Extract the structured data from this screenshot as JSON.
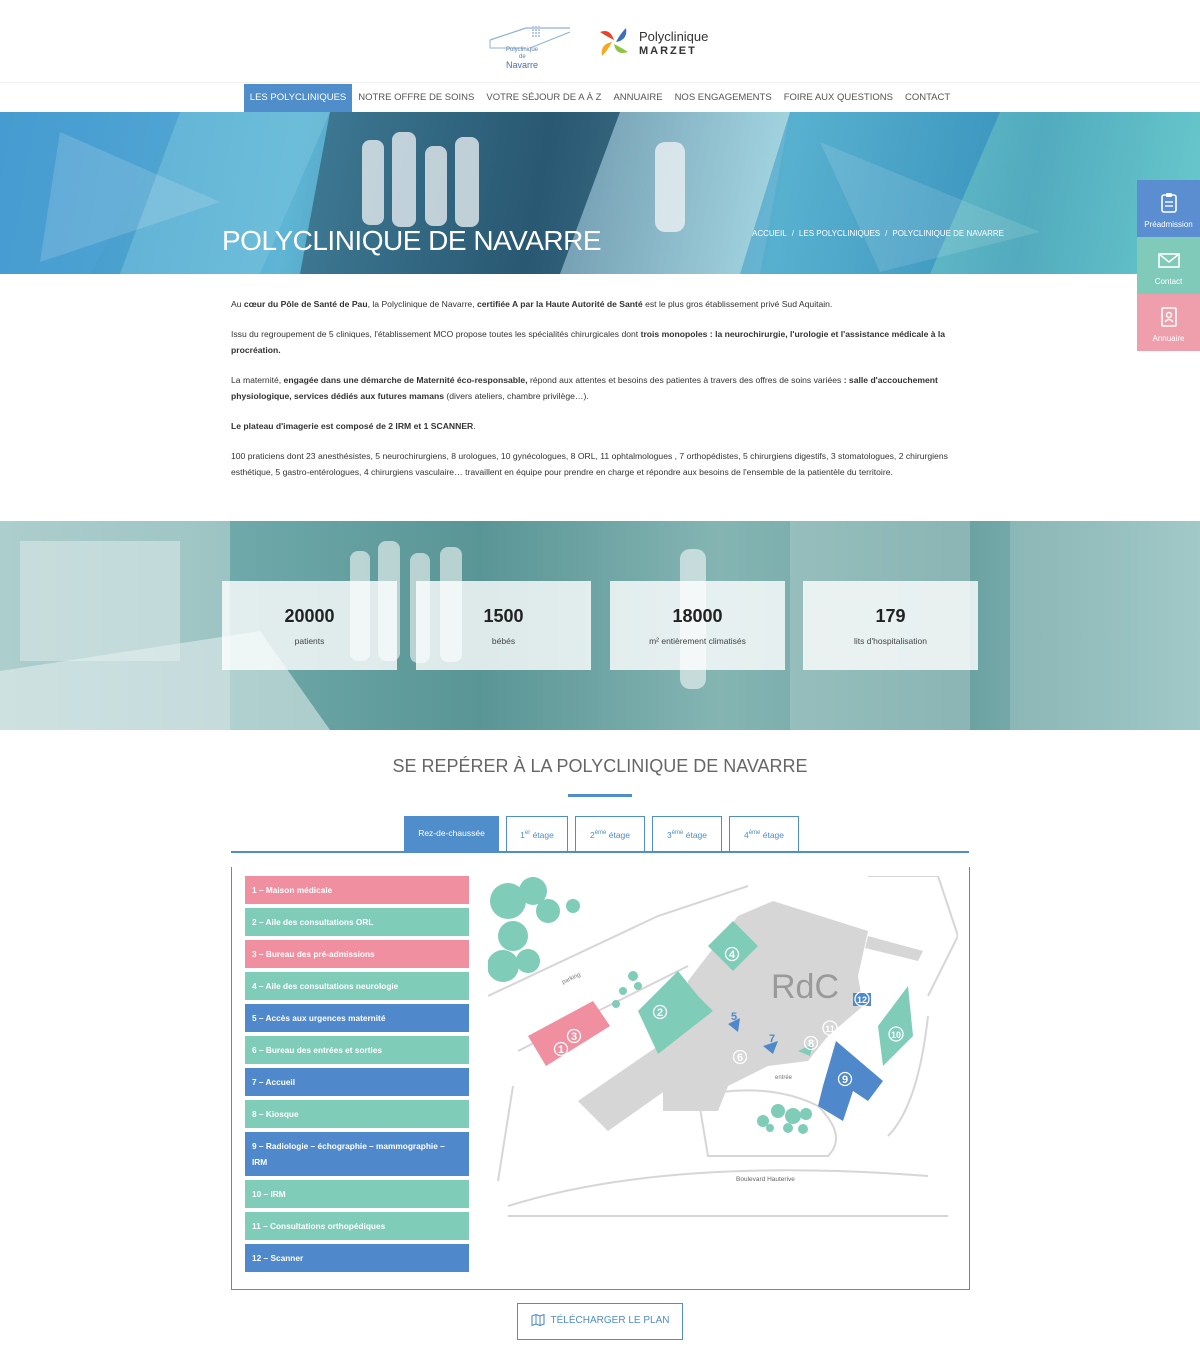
{
  "header": {
    "logo_navarre": {
      "line1": "Polyclinique",
      "line2": "de",
      "line3": "Navarre"
    },
    "logo_marzet": {
      "line1": "Polyclinique",
      "line2": "MARZET"
    }
  },
  "nav": {
    "items": [
      "LES POLYCLINIQUES",
      "NOTRE OFFRE DE SOINS",
      "VOTRE SÉJOUR DE A À Z",
      "ANNUAIRE",
      "NOS ENGAGEMENTS",
      "FOIRE AUX QUESTIONS",
      "CONTACT"
    ],
    "active_index": 0
  },
  "hero": {
    "title": "POLYCLINIQUE DE NAVARRE",
    "breadcrumb": [
      "ACCUEIL",
      "LES POLYCLINIQUES",
      "POLYCLINIQUE DE NAVARRE"
    ],
    "separator": "/"
  },
  "side_tabs": {
    "preadmission": "Préadmission",
    "contact": "Contact",
    "annuaire": "Annuaire"
  },
  "intro": {
    "p1": {
      "a": "Au ",
      "b": "cœur du Pôle de Santé de Pau",
      "c": ", la Polyclinique de Navarre, ",
      "d": "certifiée A par la Haute Autorité de Santé",
      "e": " est le plus gros établissement privé Sud Aquitain."
    },
    "p2": {
      "a": "Issu du regroupement de 5 cliniques, l'établissement MCO propose toutes les spécialités chirurgicales dont ",
      "b": "trois monopoles : la neurochirurgie, l'urologie et l'assistance médicale à la procréation."
    },
    "p3": {
      "a": "La maternité, ",
      "b": "engagée dans une démarche de Maternité éco-responsable,",
      "c": " répond aux attentes et besoins des patientes à travers des offres de soins variées ",
      "d": ": salle d'accouchement physiologique, services dédiés aux futures mamans",
      "e": " (divers ateliers, chambre privilège…)."
    },
    "p4": {
      "a": "Le plateau d'imagerie est composé de 2 IRM et  1 SCANNER",
      "b": "."
    },
    "p5": "100 praticiens dont 23 anesthésistes, 5 neurochirurgiens, 8 urologues, 10 gynécologues, 8 ORL, 11 ophtalmologues , 7 orthopédistes, 5 chirurgiens digestifs, 3 stomatologues, 2 chirurgiens esthétique, 5 gastro-entérologues, 4 chirurgiens vasculaire…  travaillent en équipe pour prendre en charge et répondre aux besoins de l'ensemble de la patientèle du territoire."
  },
  "stats": [
    {
      "value": "20000",
      "label": "patients"
    },
    {
      "value": "1500",
      "label": "bébés"
    },
    {
      "value": "18000",
      "label": "m² entièrement climatisés"
    },
    {
      "value": "179",
      "label": "lits d'hospitalisation"
    }
  ],
  "plan": {
    "title": "SE REPÉRER À LA POLYCLINIQUE DE NAVARRE",
    "tabs": [
      {
        "label": "Rez-de-chaussée",
        "sup": "",
        "after": ""
      },
      {
        "label": "1",
        "sup": "er",
        "after": " étage"
      },
      {
        "label": "2",
        "sup": "ème",
        "after": " étage"
      },
      {
        "label": "3",
        "sup": "ème",
        "after": " étage"
      },
      {
        "label": "4",
        "sup": "ème",
        "after": " étage"
      }
    ],
    "active_tab": 0,
    "legend": [
      {
        "label": "1 – Maison médicale",
        "color": "pink"
      },
      {
        "label": "2 – Aile des consultations ORL",
        "color": "green"
      },
      {
        "label": "3 – Bureau des pré-admissions",
        "color": "pink"
      },
      {
        "label": "4 – Aile des consultations neurologie",
        "color": "green"
      },
      {
        "label": "5 – Accès aux urgences maternité",
        "color": "blue"
      },
      {
        "label": "6 – Bureau des entrées et sorties",
        "color": "green"
      },
      {
        "label": "7 – Accueil",
        "color": "blue"
      },
      {
        "label": "8 – Kiosque",
        "color": "green"
      },
      {
        "label": "9 – Radiologie – échographie – mammographie – IRM",
        "color": "blue"
      },
      {
        "label": "10 – IRM",
        "color": "green"
      },
      {
        "label": "11 – Consultations orthopédiques",
        "color": "green"
      },
      {
        "label": "12 – Scanner",
        "color": "blue"
      }
    ],
    "map": {
      "floor_label": "RdC",
      "parking": "parking",
      "entree": "entrée",
      "street": "Boulevard Hauterive",
      "markers": [
        "1",
        "2",
        "3",
        "4",
        "5",
        "6",
        "7",
        "8",
        "9",
        "10",
        "11",
        "12"
      ]
    },
    "download": "TÉLÉCHARGER LE PLAN"
  },
  "colors": {
    "blue": "#4f89cb",
    "green": "#7fccb9",
    "pink": "#ef8fa0",
    "grey": "#d8d8d8"
  }
}
